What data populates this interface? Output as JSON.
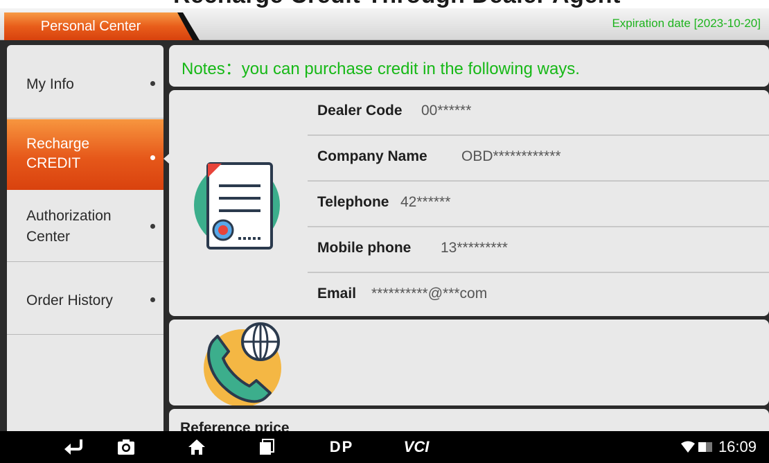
{
  "window": {
    "title_cropped": "Recharge Credit Through Dealer Agent"
  },
  "header": {
    "active_tab": "Personal Center",
    "expiration": "Expiration date [2023-10-20]"
  },
  "sidebar": {
    "items": [
      {
        "label": "My Info",
        "active": false
      },
      {
        "label": "Recharge\nCREDIT",
        "active": true
      },
      {
        "label": "Authorization\nCenter",
        "active": false
      },
      {
        "label": "Order History",
        "active": false
      }
    ]
  },
  "main": {
    "notes": "Notes：you can purchase credit in the following ways.",
    "dealer_info": [
      {
        "label": "Dealer Code",
        "value": "00******"
      },
      {
        "label": "Company Name",
        "value": "OBD************"
      },
      {
        "label": "Telephone",
        "value": "42******"
      },
      {
        "label": "Mobile phone",
        "value": "13*********"
      },
      {
        "label": "Email",
        "value": "**********@***com"
      }
    ],
    "reference_price": "Reference price"
  },
  "navbar": {
    "dp_label": "DP",
    "vci_label": "VCI",
    "time": "16:09"
  },
  "colors": {
    "accent_orange": "#e6581a",
    "notes_green": "#16b816",
    "expiration_green": "#1db31d"
  }
}
